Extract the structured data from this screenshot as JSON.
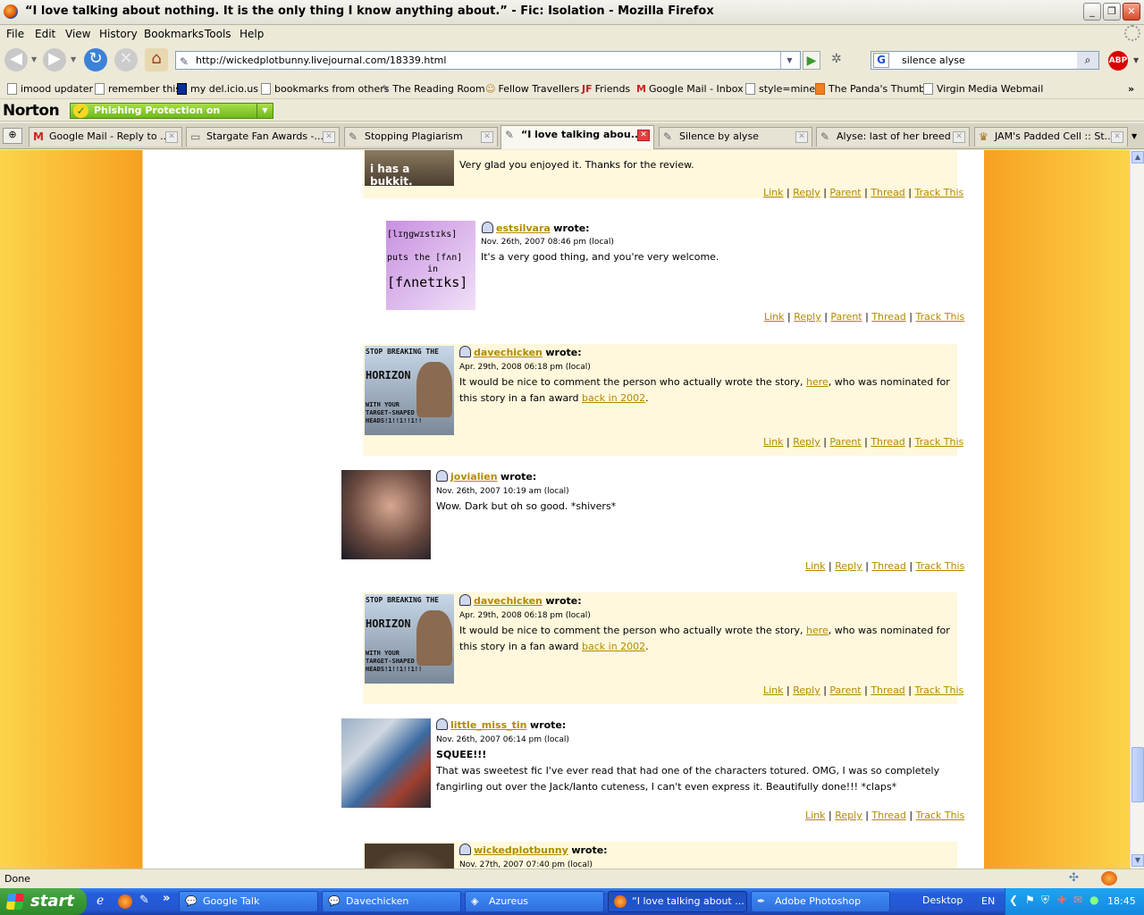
{
  "window": {
    "title": "“I love talking about nothing. It is the only thing I know anything about.” - Fic: Isolation - Mozilla Firefox"
  },
  "menu": [
    "File",
    "Edit",
    "View",
    "History",
    "Bookmarks",
    "Tools",
    "Help"
  ],
  "nav": {
    "url": "http://wickedplotbunny.livejournal.com/18339.html",
    "search": "silence alyse"
  },
  "bookmarks": [
    "imood updater",
    "remember this",
    "my del.icio.us",
    "bookmarks from others",
    "The Reading Room",
    "Fellow Travellers",
    "Friends",
    "Google Mail - Inbox",
    "style=mine",
    "The Panda's Thumb",
    "Virgin Media Webmail"
  ],
  "norton": {
    "logo": "Norton",
    "status": "Phishing Protection on"
  },
  "tabs": [
    {
      "label": "Google Mail - Reply to ..."
    },
    {
      "label": "Stargate Fan Awards -..."
    },
    {
      "label": "Stopping Plagiarism"
    },
    {
      "label": "“I love talking abou..."
    },
    {
      "label": "Silence by alyse"
    },
    {
      "label": "Alyse: last of her breed"
    },
    {
      "label": "JAM's Padded Cell :: St..."
    }
  ],
  "comments": [
    {
      "text": "Very glad you enjoyed it. Thanks for the review.",
      "avatar_text": "i has a bukkit.",
      "links": [
        "Link",
        "Reply",
        "Parent",
        "Thread",
        "Track This"
      ]
    },
    {
      "user": "estsilvara",
      "wrote": "wrote:",
      "date": "Nov. 26th, 2007 08:46 pm (local)",
      "text": "It's a very good thing, and you're very welcome.",
      "avatar_lines": [
        "[lɪŋgwɪstɪks]",
        "puts the [fʌn]",
        "in",
        "[fʌnetɪks]"
      ],
      "links": [
        "Link",
        "Reply",
        "Parent",
        "Thread",
        "Track This"
      ]
    },
    {
      "user": "davechicken",
      "wrote": "wrote:",
      "date": "Apr. 29th, 2008 06:18 pm (local)",
      "text_a": "It would be nice to comment the person who actually wrote the story, ",
      "link_a": "here",
      "text_b": ", who was nominated for this story in a fan award ",
      "link_b": "back in 2002",
      "text_c": ".",
      "avatar_lines": [
        "STOP BREAKING THE",
        "HORIZON",
        "WITH YOUR TARGET-SHAPED HEADS!1!!1!!1!!"
      ],
      "links": [
        "Link",
        "Reply",
        "Parent",
        "Thread",
        "Track This"
      ]
    },
    {
      "user": "jovialien",
      "wrote": "wrote:",
      "date": "Nov. 26th, 2007 10:19 am (local)",
      "text": "Wow. Dark but oh so good. *shivers*",
      "links": [
        "Link",
        "Reply",
        "Thread",
        "Track This"
      ]
    },
    {
      "user": "davechicken",
      "wrote": "wrote:",
      "date": "Apr. 29th, 2008 06:18 pm (local)",
      "text_a": "It would be nice to comment the person who actually wrote the story, ",
      "link_a": "here",
      "text_b": ", who was nominated for this story in a fan award ",
      "link_b": "back in 2002",
      "text_c": ".",
      "avatar_lines": [
        "STOP BREAKING THE",
        "HORIZON",
        "WITH YOUR TARGET-SHAPED HEADS!1!!1!!1!!"
      ],
      "links": [
        "Link",
        "Reply",
        "Parent",
        "Thread",
        "Track This"
      ]
    },
    {
      "user": "little_miss_tin",
      "wrote": "wrote:",
      "date": "Nov. 26th, 2007 06:14 pm (local)",
      "heading": "SQUEE!!!",
      "text": "That was sweetest fic I've ever read that had one of the characters totured. OMG, I was so completely fangirling out over the Jack/Ianto cuteness, I can't even express it. Beautifully done!!! *claps*",
      "links": [
        "Link",
        "Reply",
        "Thread",
        "Track This"
      ]
    },
    {
      "user": "wickedplotbunny",
      "wrote": "wrote:",
      "date": "Nov. 27th, 2007 07:40 pm (local)"
    }
  ],
  "status": {
    "text": "Done"
  },
  "taskbar": {
    "start": "start",
    "tasks": [
      "Google Talk",
      "Davechicken",
      "Azureus",
      "“I love talking about ...",
      "Adobe Photoshop"
    ],
    "desktop": "Desktop",
    "lang": "EN",
    "clock": "18:45"
  },
  "colors": {
    "accent": "#b38a00",
    "comment_bg": "#fff8dc",
    "page_side": "#f8a020"
  }
}
